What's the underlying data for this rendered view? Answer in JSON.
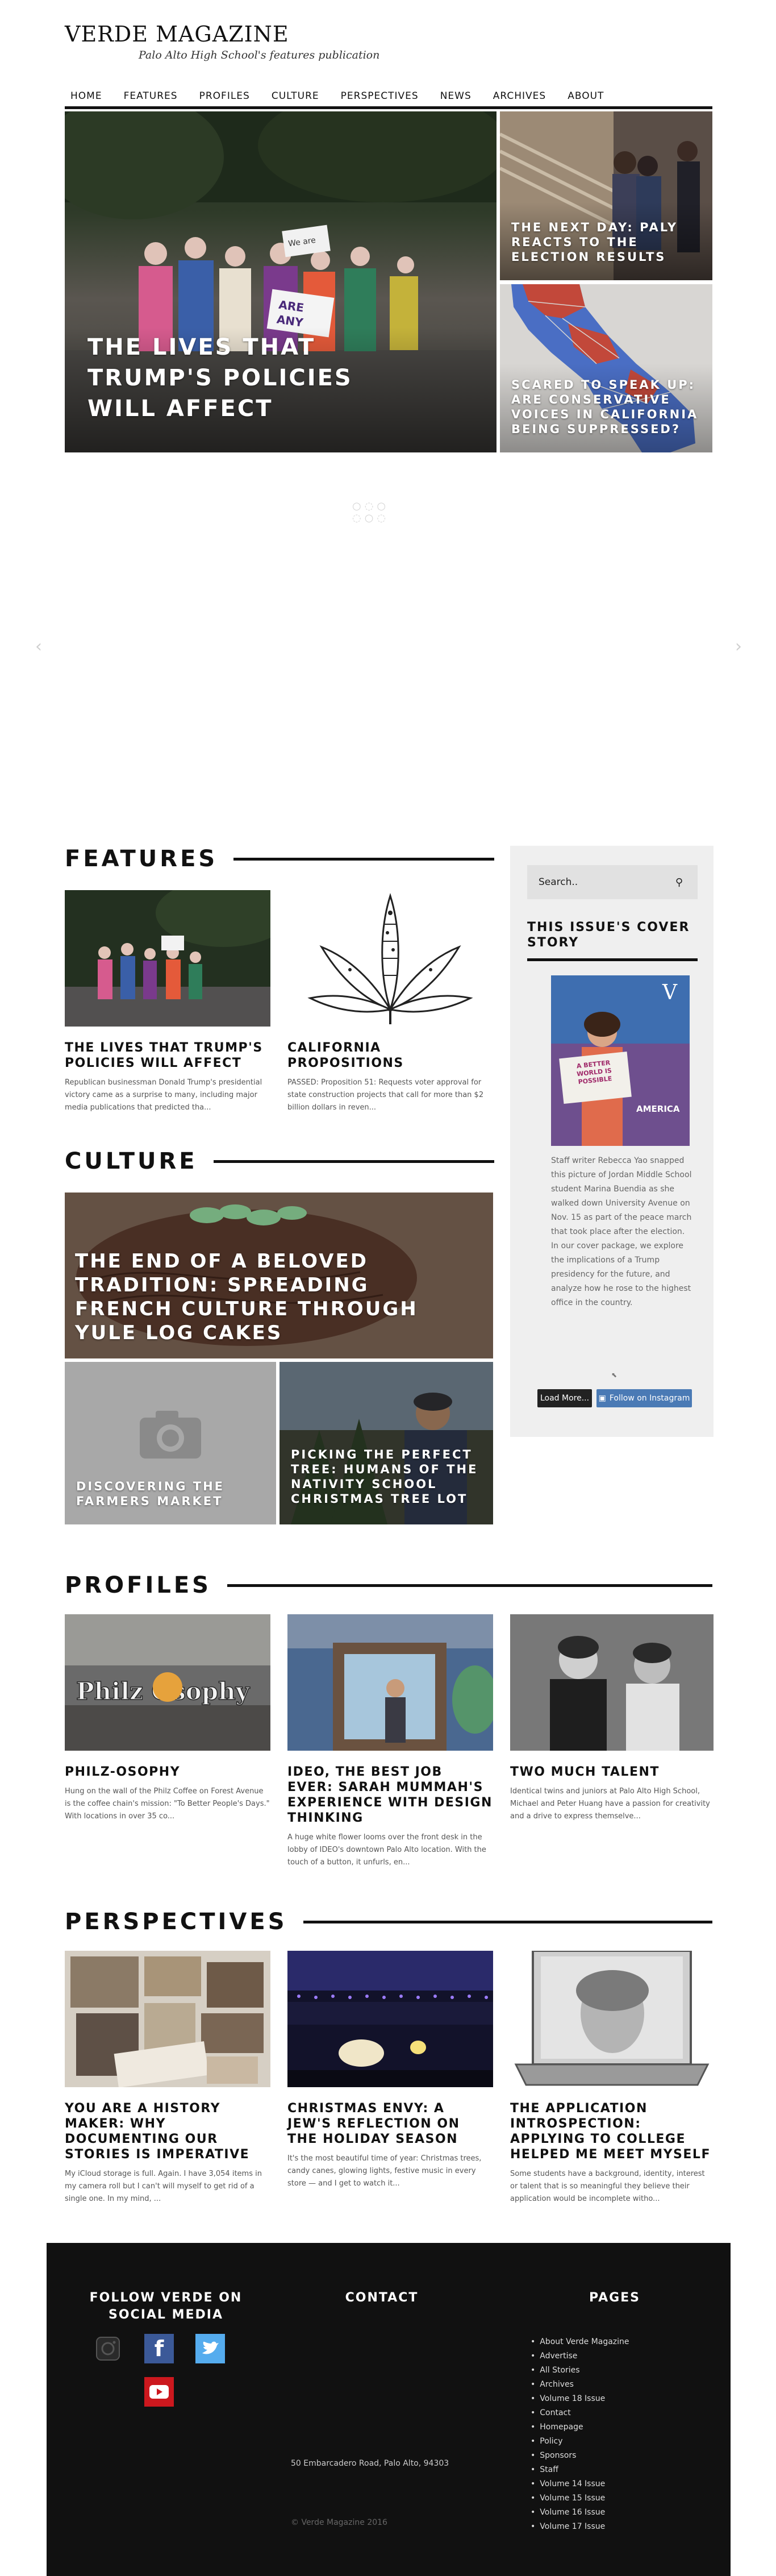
{
  "header": {
    "title": "VERDE MAGAZINE",
    "tagline": "Palo Alto High School's features publication"
  },
  "nav": [
    "HOME",
    "FEATURES",
    "PROFILES",
    "CULTURE",
    "PERSPECTIVES",
    "NEWS",
    "ARCHIVES",
    "ABOUT"
  ],
  "hero": {
    "main": "THE LIVES THAT TRUMP'S POLICIES WILL AFFECT",
    "side_top": "THE NEXT DAY: PALY REACTS TO THE ELECTION RESULTS",
    "side_bottom": "SCARED TO SPEAK UP: ARE CONSERVATIVE VOICES IN CALIFORNIA BEING SUPPRESSED?",
    "protest_signs": [
      "We are",
      "ARE",
      "ANY"
    ]
  },
  "features": {
    "heading": "FEATURES",
    "cards": [
      {
        "title": "THE LIVES THAT TRUMP'S POLICIES WILL AFFECT",
        "excerpt": "Republican businessman Donald Trump's presidential victory came as a surprise to many, including major media publications that predicted tha..."
      },
      {
        "title": "CALIFORNIA PROPOSITIONS",
        "excerpt": "PASSED: Proposition 51: Requests voter approval for state construction projects that call for more than $2 billion dollars in reven..."
      }
    ]
  },
  "culture": {
    "heading": "CULTURE",
    "main": "THE END OF A BELOVED TRADITION: SPREADING FRENCH CULTURE THROUGH YULE LOG CAKES",
    "left": "DISCOVERING THE FARMERS MARKET",
    "right": "PICKING THE PERFECT TREE: HUMANS OF THE NATIVITY SCHOOL CHRISTMAS TREE LOT"
  },
  "sidebar": {
    "search_placeholder": "Search..",
    "cover_title": "THIS ISSUE'S COVER STORY",
    "cover_text": "Staff writer Rebecca Yao snapped this picture of Jordan Middle School student Marina Buendia as she walked down University Avenue on Nov. 15 as part of the peace march that took place after the election. In our cover package, we explore the implications of a Trump presidency for the future, and analyze how he rose to the highest office in the country.",
    "cover_art": {
      "letter": "V",
      "sign": "A BETTER WORLD IS POSSIBLE",
      "headline": "AMERICA"
    },
    "load_more": "Load More...",
    "follow": "Follow on Instagram"
  },
  "profiles": {
    "heading": "PROFILES",
    "cards": [
      {
        "title": "PHILZ-OSOPHY",
        "image_text": "Philz Osophy",
        "excerpt": "Hung on the wall of the Philz Coffee on Forest Avenue is the coffee chain's mission: \"To Better People's Days.\" With locations in over 35 co..."
      },
      {
        "title": "IDEO, THE BEST JOB EVER: SARAH MUMMAH'S EXPERIENCE WITH DESIGN THINKING",
        "excerpt": "A huge white flower looms over the front desk in the lobby of IDEO's downtown Palo Alto location. With the touch of a button, it unfurls, en..."
      },
      {
        "title": "TWO MUCH TALENT",
        "excerpt": "Identical twins and juniors at Palo Alto High School, Michael and Peter Huang have a passion for creativity and a drive to express themselve..."
      }
    ]
  },
  "perspectives": {
    "heading": "PERSPECTIVES",
    "cards": [
      {
        "title": "YOU ARE A HISTORY MAKER: WHY DOCUMENTING OUR STORIES IS IMPERATIVE",
        "excerpt": "My iCloud storage is full. Again. I have 3,054 items in my camera roll but I can't will myself to get rid of a single one. In my mind, ..."
      },
      {
        "title": "CHRISTMAS ENVY: A JEW'S REFLECTION ON THE HOLIDAY SEASON",
        "excerpt": "It's the most beautiful time of year: Christmas trees, candy canes, glowing lights, festive music in every store — and I get to watch it..."
      },
      {
        "title": "THE APPLICATION INTROSPECTION: APPLYING TO COLLEGE HELPED ME MEET MYSELF",
        "excerpt": "Some students have a background, identity, interest or talent that is so meaningful they believe their application would be incomplete witho..."
      }
    ]
  },
  "footer": {
    "social_heading": "FOLLOW VERDE ON SOCIAL MEDIA",
    "contact_heading": "CONTACT",
    "pages_heading": "PAGES",
    "address": "50 Embarcadero Road, Palo Alto, 94303",
    "copyright": "© Verde Magazine 2016",
    "pages": [
      "About Verde Magazine",
      "Advertise",
      "All Stories",
      "Archives",
      "Volume 18 Issue",
      "Contact",
      "Homepage",
      "Policy",
      "Sponsors",
      "Staff",
      "Volume 14 Issue",
      "Volume 15 Issue",
      "Volume 16 Issue",
      "Volume 17 Issue"
    ]
  },
  "colors": {
    "accent": "#111111",
    "sidebar_bg": "#efefef",
    "footer_bg": "#111111",
    "facebook": "#3b5998",
    "twitter": "#55acee",
    "youtube": "#cc181e",
    "instagram_btn": "#4a7ab5"
  }
}
